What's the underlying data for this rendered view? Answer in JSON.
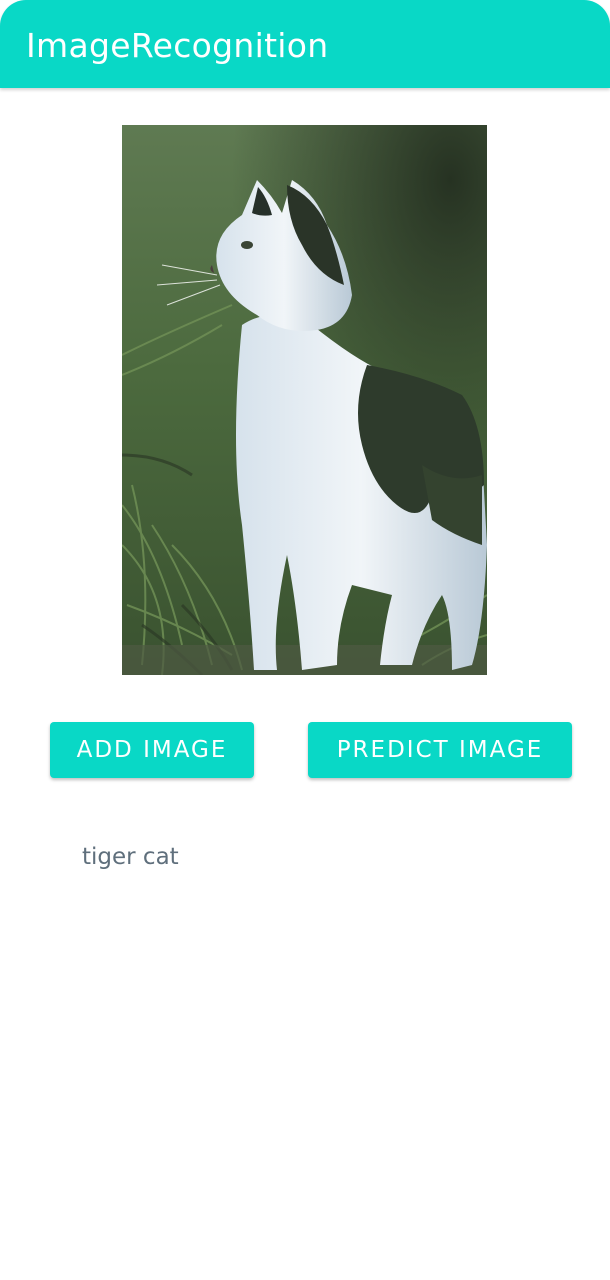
{
  "app_bar": {
    "title": "ImageRecognition",
    "color": "#09d8c6"
  },
  "image_view": {
    "subject_icon": "cat-photo"
  },
  "actions": {
    "add_image_label": "ADD IMAGE",
    "predict_image_label": "PREDICT IMAGE",
    "button_color": "#09d8c6"
  },
  "result": {
    "text": "tiger cat"
  }
}
